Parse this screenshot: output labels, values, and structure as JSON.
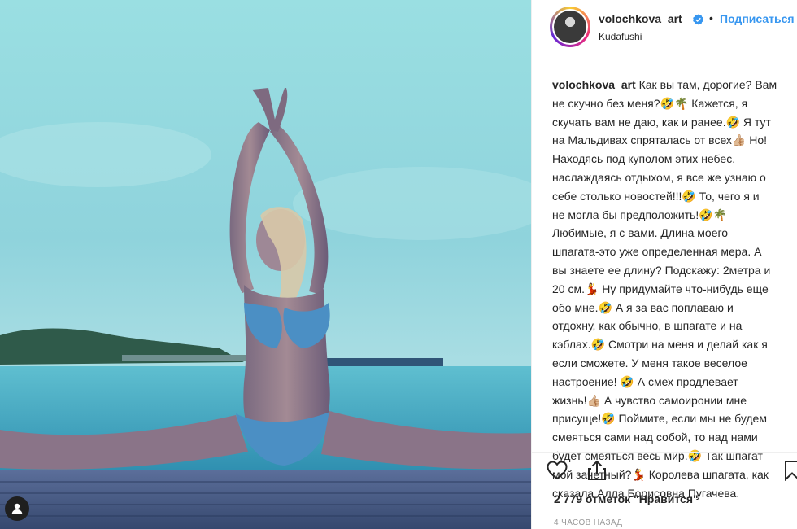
{
  "post": {
    "username": "volochkova_art",
    "separator": "•",
    "follow_label": "Подписаться",
    "location": "Kudafushi",
    "caption_user": "volochkova_art",
    "caption_lines": [
      "Как вы там, дорогие? Вам",
      "не скучно без меня?🤣🌴 Кажется, я",
      "скучать вам не даю, как и ранее.🤣 Я тут",
      "на Мальдивах спряталась от всех👍🏼 Но!",
      "Находясь под куполом этих небес,",
      "наслаждаясь отдыхом, я все же узнаю о",
      "себе столько новостей!!!🤣 То, чего я и",
      "не могла бы предположить!🤣🌴",
      "Любимые, я с вами. Длина моего",
      "шпагата-это уже определенная мера. А",
      "вы знаете ее длину? Подскажу: 2метра и",
      "20 см.💃 Ну придумайте что-нибудь еще",
      "обо мне.🤣 А я за вас поплаваю и",
      "отдохну, как обычно, в шпагате и на",
      "кэблах.🤣 Смотри на меня и делай как я",
      "если сможете. У меня такое веселое",
      "настроение! 🤣 А смех продлевает",
      "жизнь!👍🏼 А чувство самоиронии мне",
      "присуще!🤣 Поймите, если мы не будем",
      "смеяться сами над собой, то над нами",
      "будет смеяться весь мир.🤣 Так шпагат",
      "мой зачетный?💃 Королева шпагата, как",
      "сказала Алла Борисовна Пугачева."
    ],
    "likes": "2 779 отметок \"Нравится\"",
    "time_ago": "4 ЧАСОВ НАЗАД"
  },
  "icons": {
    "like": "heart-icon",
    "share": "share-icon",
    "save": "bookmark-icon",
    "tag": "user-tag-icon",
    "verified": "verified-badge-icon"
  },
  "colors": {
    "accent": "#3897f0",
    "text": "#262626",
    "muted": "#999999",
    "sky": "#8fd6dc",
    "sea": "#4fb3c9"
  }
}
